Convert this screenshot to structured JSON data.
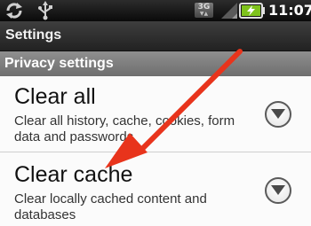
{
  "status_bar": {
    "icons": [
      "sync-icon",
      "usb-icon",
      "network-3g-icon",
      "signal-icon",
      "battery-charging-icon"
    ],
    "network_type": "3G",
    "time": "11:07"
  },
  "title_bar": {
    "title": "Settings"
  },
  "section": {
    "label": "Privacy settings"
  },
  "items": [
    {
      "title": "Clear all",
      "summary": "Clear all history, cache, cookies, form data and passwords",
      "icon": "expand-circle-icon"
    },
    {
      "title": "Clear cache",
      "summary": "Clear locally cached content and databases",
      "icon": "expand-circle-icon"
    }
  ],
  "annotation": {
    "icon": "red-arrow-icon",
    "color": "#e8341c"
  }
}
